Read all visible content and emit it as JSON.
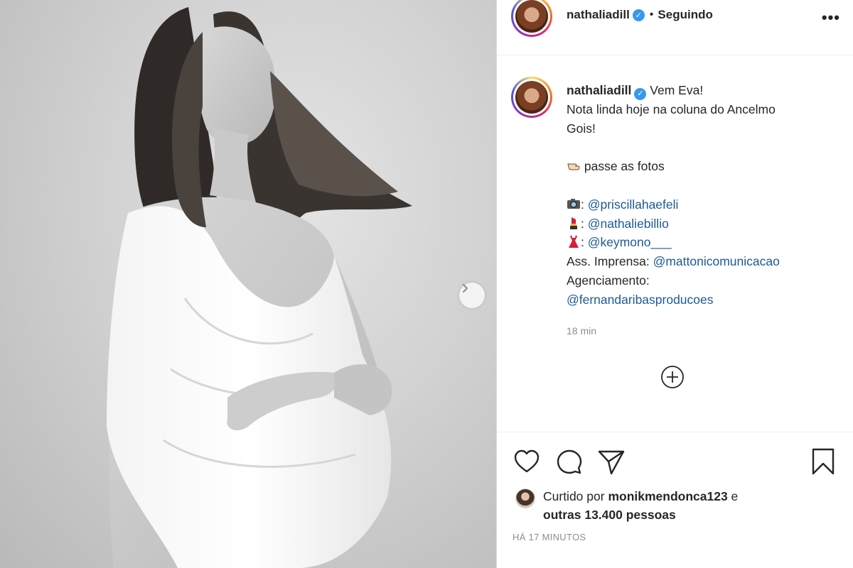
{
  "post": {
    "username": "nathaliadill",
    "follow_separator": "•",
    "follow_status": "Seguindo",
    "more_label": "•••"
  },
  "caption": {
    "username": "nathaliadill",
    "line1": "Vem Eva!",
    "line2": "Nota linda hoje na coluna do Ancelmo",
    "line3": "Gois!",
    "pointer_text": "passe as fotos",
    "credits": [
      {
        "icon": "camera-icon",
        "prefix": ": ",
        "handle": "@priscillahaefeli"
      },
      {
        "icon": "lipstick-icon",
        "prefix": ": ",
        "handle": "@nathaliebillio"
      },
      {
        "icon": "dress-icon",
        "prefix": ": ",
        "handle": "@keymono___"
      }
    ],
    "press_label": "Ass. Imprensa: ",
    "press_handle": "@mattonicomunicacao",
    "agency_label": "Agenciamento:",
    "agency_handle": "@fernandaribasproducoes",
    "time_ago": "18 min"
  },
  "likes": {
    "prefix": "Curtido por ",
    "liker": "monikmendonca123",
    "suffix": " e",
    "others": "outras 13.400 pessoas"
  },
  "post_date": "HÁ 17 MINUTOS",
  "colors": {
    "link": "#1d5a94",
    "verified": "#3897f0",
    "muted": "#8e8e8e",
    "text": "#262626"
  }
}
